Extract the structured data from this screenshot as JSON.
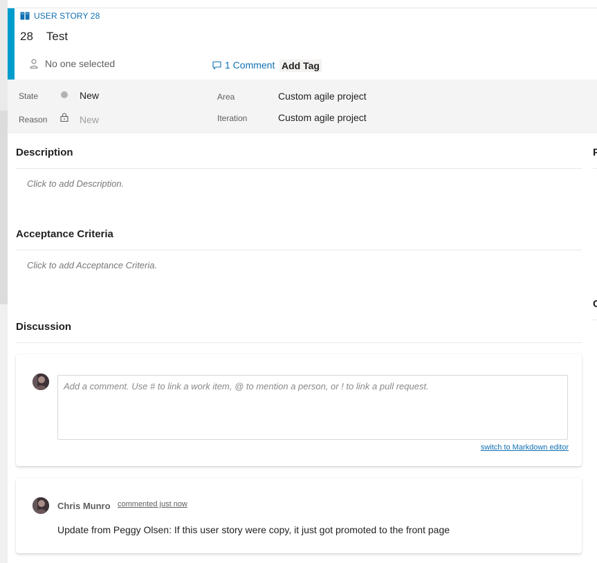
{
  "work_item": {
    "type_label": "USER STORY 28",
    "id": "28",
    "title": "Test",
    "assigned_to": "No one selected",
    "comments_label": "1 Comment",
    "add_tag_label": "Add Tag",
    "accent_color": "#009ccc"
  },
  "fields": {
    "state_label": "State",
    "state_value": "New",
    "reason_label": "Reason",
    "reason_value": "New",
    "area_label": "Area",
    "area_value": "Custom agile project",
    "iteration_label": "Iteration",
    "iteration_value": "Custom agile project"
  },
  "sections": {
    "description_title": "Description",
    "description_placeholder": "Click to add Description.",
    "acceptance_title": "Acceptance Criteria",
    "acceptance_placeholder": "Click to add Acceptance Criteria.",
    "discussion_title": "Discussion"
  },
  "right_column": {
    "heading_1": "P",
    "heading_2": "C"
  },
  "discussion": {
    "comment_placeholder": "Add a comment. Use # to link a work item, @ to mention a person, or ! to link a pull request.",
    "markdown_link": "switch to Markdown editor",
    "comments": [
      {
        "author": "Chris Munro",
        "timestamp": "commented just now",
        "text": "Update from Peggy Olsen: If this user story were copy, it just got promoted to the front page"
      }
    ]
  }
}
